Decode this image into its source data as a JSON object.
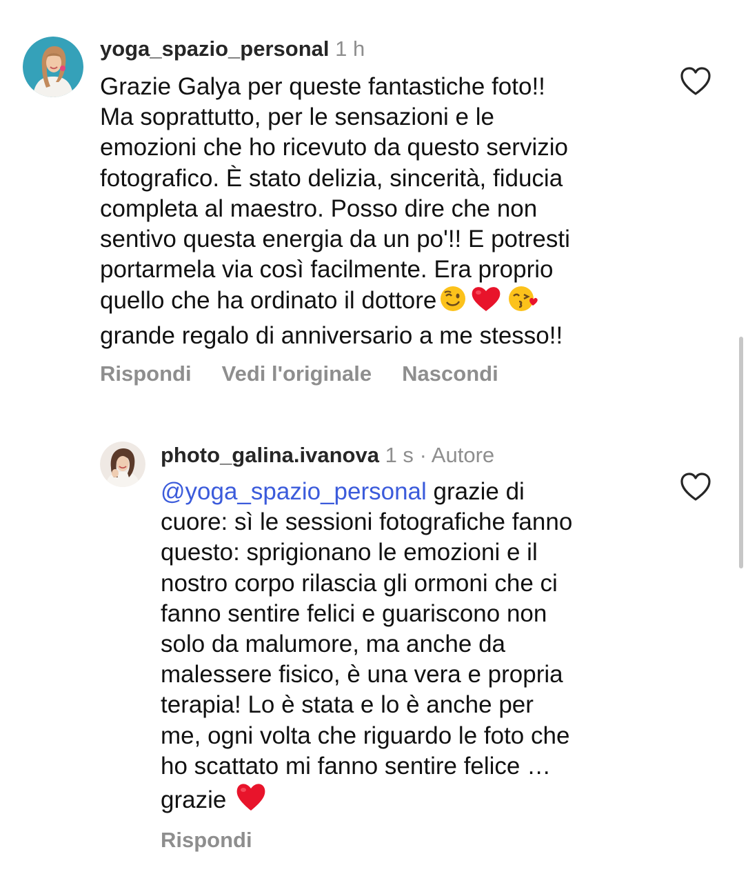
{
  "comments": [
    {
      "username": "yoga_spazio_personal",
      "time": "1 h",
      "text": "Grazie Galya per queste fantastiche foto!!\nMa soprattutto, per le sensazioni e le\nemozioni che ho ricevuto da questo servizio\nfotografico. È stato delizia, sincerità, fiducia\ncompleta al maestro. Posso dire che non\nsentivo questa energia da un po'!! E potresti\nportarmela via così facilmente. Era proprio\nquello che ha ordinato il dottore",
      "text_end": "grande regalo di anniversario a me stesso!!",
      "emojis": [
        "winking-face",
        "red-heart",
        "face-blowing-kiss"
      ],
      "actions": {
        "reply": "Rispondi",
        "see_original": "Vedi l'originale",
        "hide": "Nascondi"
      },
      "avatar": "avatar-yoga"
    },
    {
      "username": "photo_galina.ivanova",
      "time": "1 s",
      "separator": "·",
      "badge": "Autore",
      "mention": "@yoga_spazio_personal",
      "text": " grazie di\ncuore: sì le sessioni fotografiche fanno\nquesto: sprigionano le emozioni e il\nnostro corpo rilascia gli ormoni che ci\nfanno sentire felici e guariscono non\nsolo da malumore, ma anche da\nmalessere fisico, è una vera e propria\nterapia! Lo è stata e lo è anche per\nme, ogni volta che riguardo le foto che\nho scattato mi fanno sentire felice …\ngrazie ",
      "emojis": [
        "red-heart"
      ],
      "actions": {
        "reply": "Rispondi"
      },
      "avatar": "avatar-galina"
    }
  ],
  "colors": {
    "text": "#111111",
    "username": "#262626",
    "muted": "#8e8e8e",
    "mention": "#3b5bdb",
    "heart": "#e8142b"
  }
}
